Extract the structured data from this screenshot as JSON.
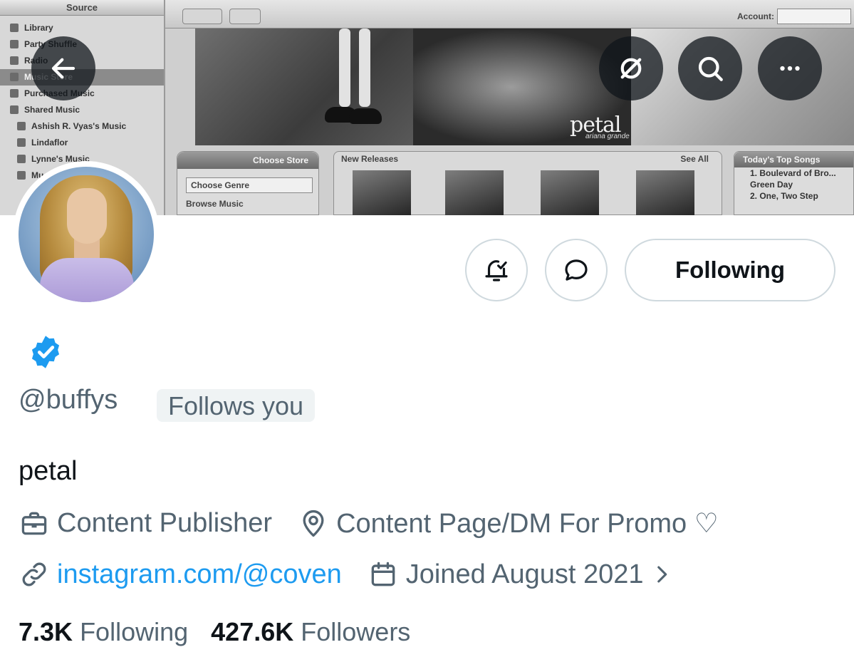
{
  "banner": {
    "source_header": "Source",
    "sources": [
      {
        "label": "Library",
        "kind": "top"
      },
      {
        "label": "Party Shuffle",
        "kind": "top"
      },
      {
        "label": "Radio",
        "kind": "top"
      },
      {
        "label": "Music Store",
        "kind": "selected"
      },
      {
        "label": "Purchased Music",
        "kind": "top"
      },
      {
        "label": "Shared Music",
        "kind": "top"
      },
      {
        "label": "Ashish R. Vyas's Music",
        "kind": "sub"
      },
      {
        "label": "Lindaflor",
        "kind": "sub"
      },
      {
        "label": "Lynne's Music",
        "kind": "sub"
      },
      {
        "label": "Mu",
        "kind": "sub"
      }
    ],
    "account_label": "Account:",
    "album_caption": "petal",
    "album_subcaption": "ariana grande",
    "choose_store": "Choose Store",
    "choose_genre": "Choose Genre",
    "browse_music": "Browse Music",
    "new_releases": "New Releases",
    "see_all": "See All",
    "top_songs_header": "Today's Top Songs",
    "top_songs": [
      "1. Boulevard of Bro...",
      "Green Day",
      "2. One, Two Step"
    ]
  },
  "topbar": {
    "back_icon": "back-arrow-icon",
    "grok_icon": "slashed-circle-icon",
    "search_icon": "search-icon",
    "more_icon": "more-icon"
  },
  "actions": {
    "notify_icon": "bell-check-icon",
    "message_icon": "chat-bubble-icon",
    "follow_label": "Following"
  },
  "profile": {
    "verified_color": "#1d9bf0",
    "handle": "@buffys",
    "follows_you": "Follows you",
    "bio": "petal",
    "category": "Content Publisher",
    "location": "Content Page/DM For Promo ♡",
    "website": "instagram.com/@coven",
    "joined": "Joined August 2021",
    "following_count": "7.3K",
    "following_label": "Following",
    "followers_count": "427.6K",
    "followers_label": "Followers"
  },
  "colors": {
    "accent": "#1d9bf0",
    "text_primary": "#0f1419",
    "text_secondary": "#536471",
    "border": "#cfd9de"
  }
}
